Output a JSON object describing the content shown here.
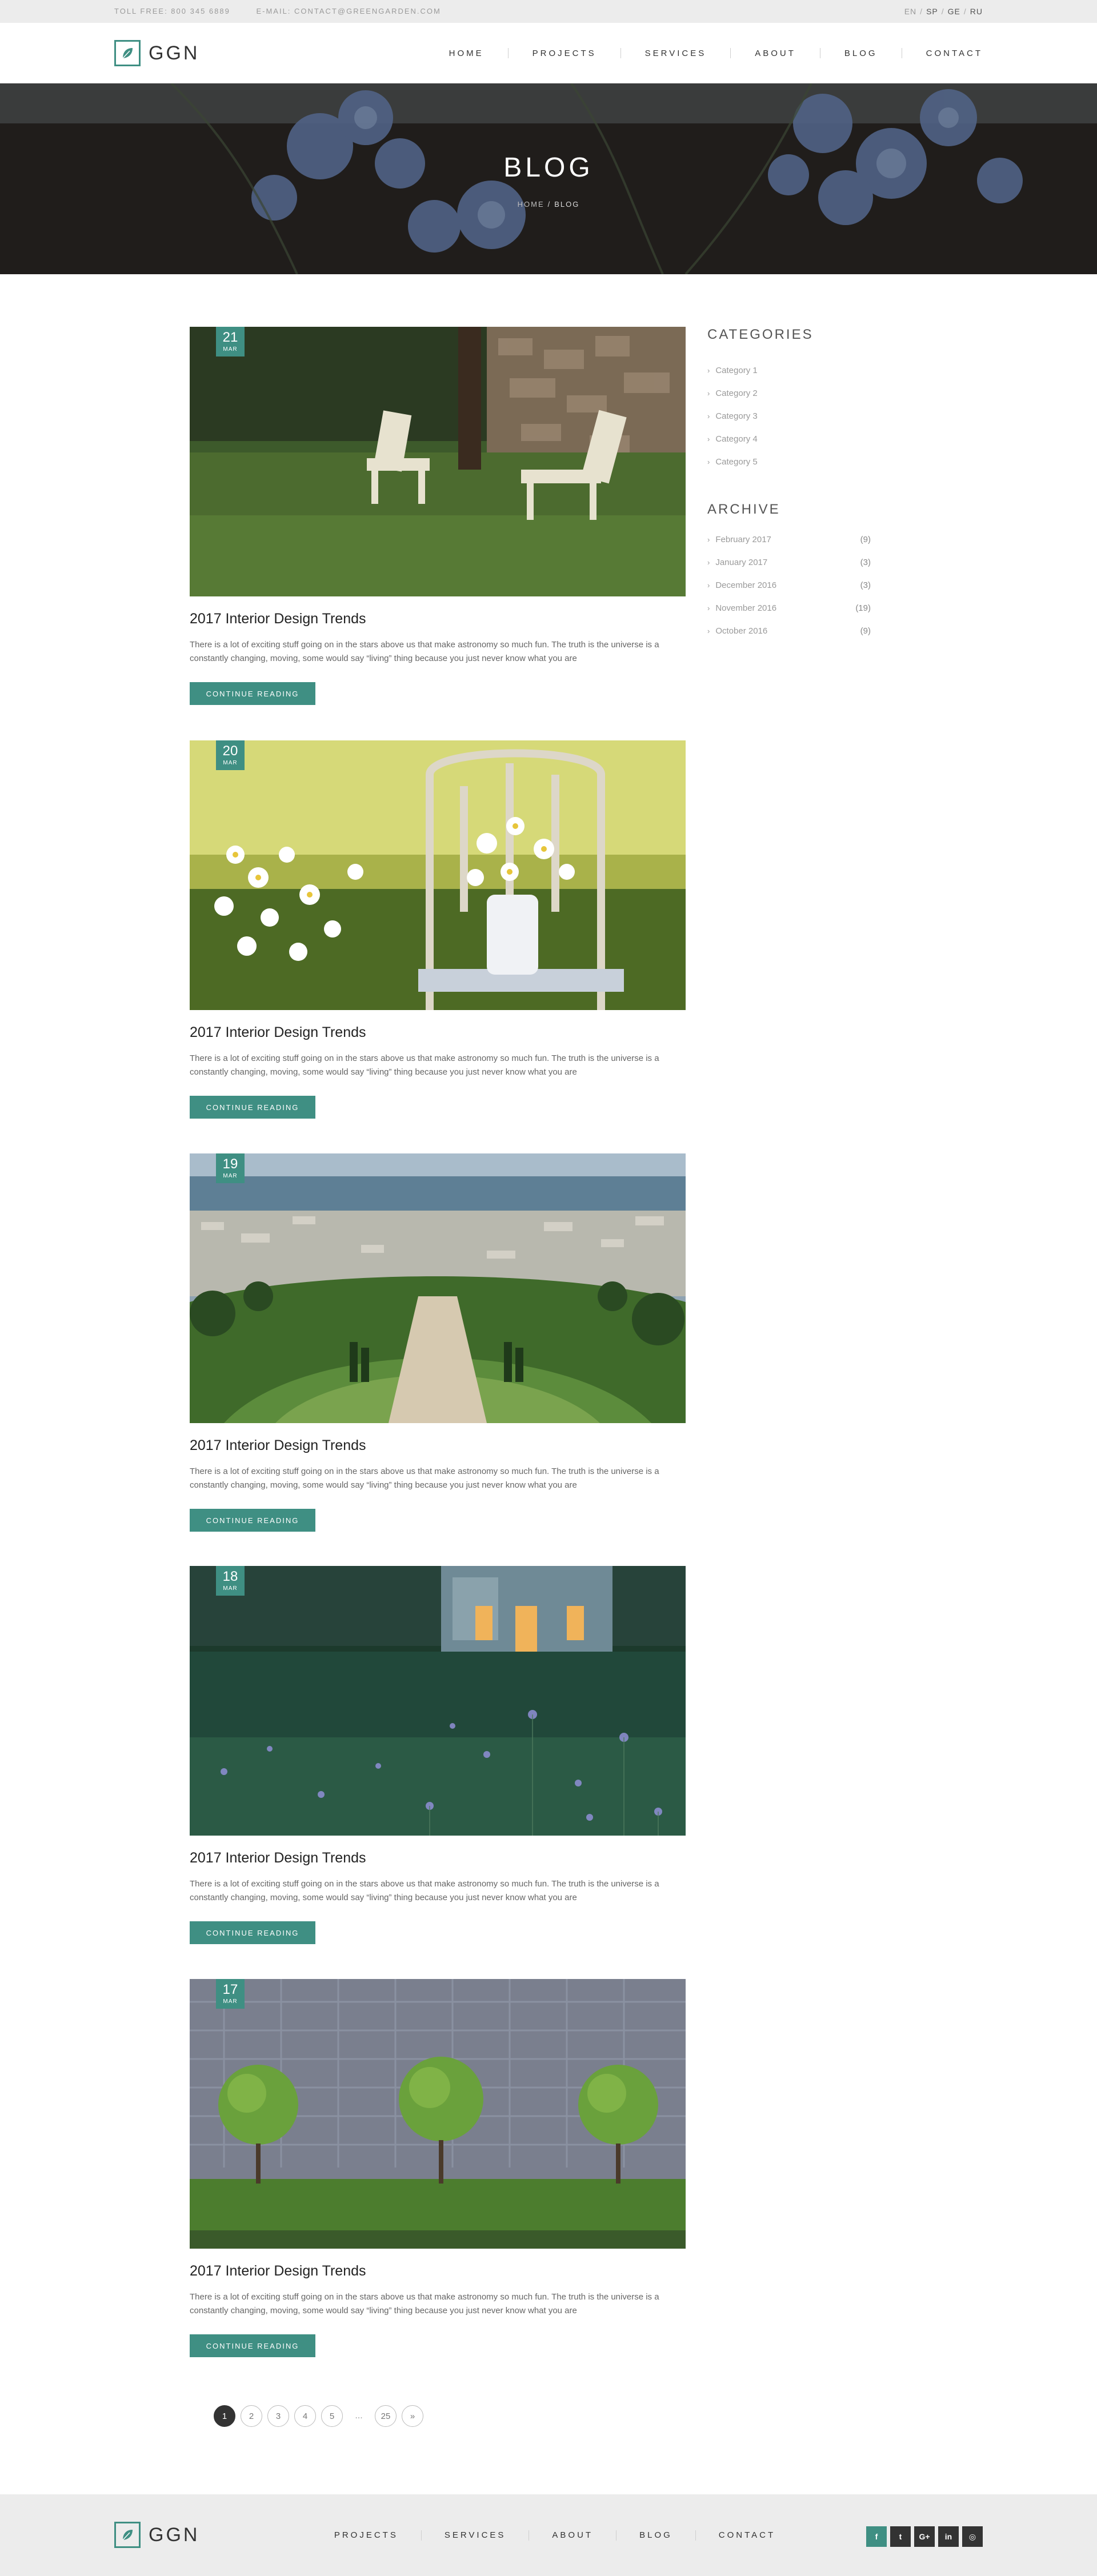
{
  "topbar": {
    "toll_free": "TOLL FREE: 800 345 6889",
    "email": "E-MAIL: CONTACT@GREENGARDEN.COM",
    "languages": [
      "EN",
      "SP",
      "GE",
      "RU"
    ],
    "current_language": "EN"
  },
  "header": {
    "logo_text": "GGN",
    "logo_icon": "leaf-icon",
    "nav": [
      "HOME",
      "PROJECTS",
      "SERVICES",
      "ABOUT",
      "BLOG",
      "CONTACT"
    ]
  },
  "hero": {
    "title": "BLOG",
    "breadcrumb": {
      "home": "HOME",
      "separator": "/",
      "current": "BLOG"
    }
  },
  "posts": [
    {
      "day": "21",
      "month": "MAR",
      "title": "2017 Interior Design Trends",
      "excerpt": "There is a lot of exciting stuff going on in the stars above us that make astronomy so much fun. The truth is the universe is a constantly changing, moving, some would say “living” thing because you just never know what you are",
      "button": "CONTINUE READING",
      "image": "garden-chairs-photo"
    },
    {
      "day": "20",
      "month": "MAR",
      "title": "2017 Interior Design Trends",
      "excerpt": "There is a lot of exciting stuff going on in the stars above us that make astronomy so much fun. The truth is the universe is a constantly changing, moving, some would say “living” thing because you just never know what you are",
      "button": "CONTINUE READING",
      "image": "daisies-on-chair-photo"
    },
    {
      "day": "19",
      "month": "MAR",
      "title": "2017 Interior Design Trends",
      "excerpt": "There is a lot of exciting stuff going on in the stars above us that make astronomy so much fun. The truth is the universe is a constantly changing, moving, some would say “living” thing because you just never know what you are",
      "button": "CONTINUE READING",
      "image": "terraced-gardens-city-photo"
    },
    {
      "day": "18",
      "month": "MAR",
      "title": "2017 Interior Design Trends",
      "excerpt": "There is a lot of exciting stuff going on in the stars above us that make astronomy so much fun. The truth is the universe is a constantly changing, moving, some would say “living” thing because you just never know what you are",
      "button": "CONTINUE READING",
      "image": "house-meadow-dusk-photo"
    },
    {
      "day": "17",
      "month": "MAR",
      "title": "2017 Interior Design Trends",
      "excerpt": "There is a lot of exciting stuff going on in the stars above us that make astronomy so much fun. The truth is the universe is a constantly changing, moving, some would say “living” thing because you just never know what you are",
      "button": "CONTINUE READING",
      "image": "topiary-trees-stone-wall-photo"
    }
  ],
  "sidebar": {
    "categories_title": "CATEGORIES",
    "categories": [
      "Category 1",
      "Category 2",
      "Category 3",
      "Category 4",
      "Category 5"
    ],
    "archive_title": "ARCHIVE",
    "archive": [
      {
        "label": "February 2017",
        "count": "(9)"
      },
      {
        "label": "January 2017",
        "count": "(3)"
      },
      {
        "label": "December 2016",
        "count": "(3)"
      },
      {
        "label": "November 2016",
        "count": "(19)"
      },
      {
        "label": "October 2016",
        "count": "(9)"
      }
    ]
  },
  "pagination": {
    "pages": [
      "1",
      "2",
      "3",
      "4",
      "5"
    ],
    "ellipsis": "...",
    "last": "25",
    "next": "»",
    "current": "1"
  },
  "footer": {
    "logo_text": "GGN",
    "nav": [
      "PROJECTS",
      "SERVICES",
      "ABOUT",
      "BLOG",
      "CONTACT"
    ],
    "socials": [
      {
        "icon": "facebook-icon",
        "glyph": "f"
      },
      {
        "icon": "twitter-icon",
        "glyph": "t"
      },
      {
        "icon": "google-plus-icon",
        "glyph": "G+"
      },
      {
        "icon": "linkedin-icon",
        "glyph": "in"
      },
      {
        "icon": "instagram-icon",
        "glyph": "◎"
      }
    ]
  },
  "colors": {
    "accent": "#3f8f83",
    "topbar_bg": "#ececec",
    "dark": "#333333"
  }
}
